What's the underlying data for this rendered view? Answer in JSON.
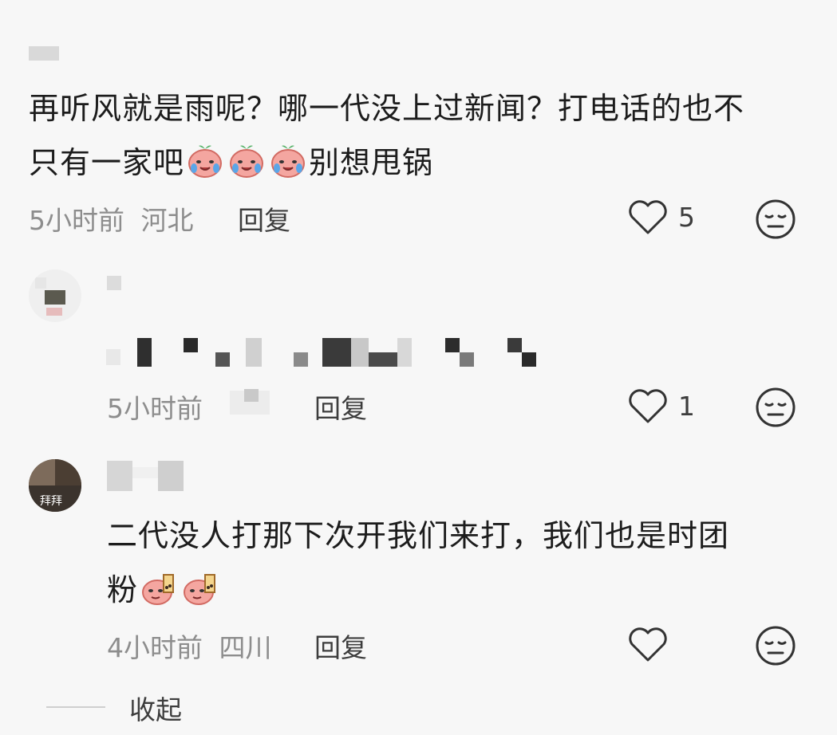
{
  "comments": [
    {
      "text_line1": "再听风就是雨呢？哪一代没上过新闻？打电话的也不",
      "text_line2": "只有一家吧",
      "text_line2_tail": "别想甩锅",
      "emoji": "crying-peach-emoji",
      "emoji_count": 3,
      "time": "5小时前",
      "location": "河北",
      "reply_label": "回复",
      "likes": "5"
    },
    {
      "time": "5小时前",
      "reply_label": "回复",
      "likes": "1"
    },
    {
      "text_line1": "二代没人打那下次开我们来打，我们也是时团",
      "text_line2": "粉",
      "emoji": "bubbletea-peach-emoji",
      "emoji_count": 2,
      "avatar_text": "拜拜",
      "time": "4小时前",
      "location": "四川",
      "reply_label": "回复",
      "likes": ""
    }
  ],
  "collapse_label": "收起",
  "icons": {
    "like": "heart-outline-icon",
    "reaction": "meh-face-icon"
  },
  "colors": {
    "background": "#f7f7f7",
    "text": "#1c1c1c",
    "meta": "#8d8d8d"
  }
}
